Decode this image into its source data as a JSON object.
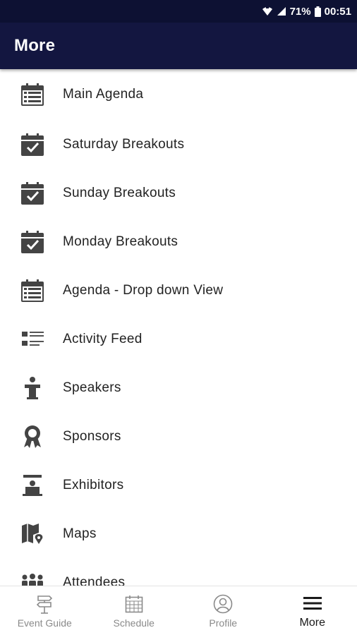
{
  "status_bar": {
    "battery": "71%",
    "time": "00:51"
  },
  "header": {
    "title": "More"
  },
  "menu": {
    "items": [
      {
        "label": "Main Agenda",
        "icon": "calendar-list-icon"
      },
      {
        "label": "Saturday Breakouts",
        "icon": "calendar-check-icon"
      },
      {
        "label": "Sunday Breakouts",
        "icon": "calendar-check-icon"
      },
      {
        "label": "Monday Breakouts",
        "icon": "calendar-check-icon"
      },
      {
        "label": "Agenda - Drop down View",
        "icon": "calendar-list-icon"
      },
      {
        "label": "Activity Feed",
        "icon": "feed-list-icon"
      },
      {
        "label": "Speakers",
        "icon": "podium-icon"
      },
      {
        "label": "Sponsors",
        "icon": "ribbon-award-icon"
      },
      {
        "label": "Exhibitors",
        "icon": "booth-icon"
      },
      {
        "label": "Maps",
        "icon": "map-pin-icon"
      },
      {
        "label": "Attendees",
        "icon": "people-icon"
      }
    ]
  },
  "bottom_nav": {
    "items": [
      {
        "label": "Event Guide",
        "icon": "signpost-icon",
        "active": false
      },
      {
        "label": "Schedule",
        "icon": "calendar-grid-icon",
        "active": false
      },
      {
        "label": "Profile",
        "icon": "profile-icon",
        "active": false
      },
      {
        "label": "More",
        "icon": "hamburger-menu-icon",
        "active": true
      }
    ]
  },
  "colors": {
    "status_bar": "#0d1133",
    "app_bar": "#131640",
    "icon": "#444444",
    "inactive_nav": "#8a8a8a"
  }
}
